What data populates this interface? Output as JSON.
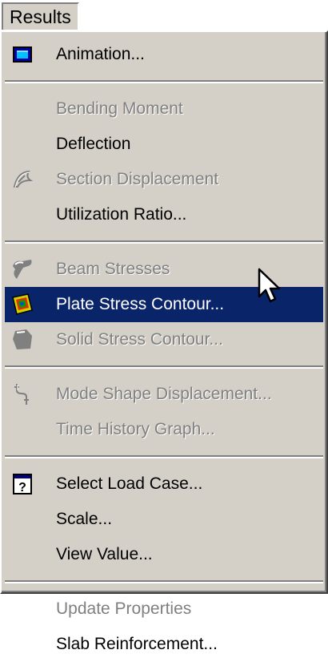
{
  "menu_title": "Results",
  "groups": [
    {
      "items": [
        {
          "label": "Animation...",
          "icon": "animation-icon",
          "enabled": true
        }
      ]
    },
    {
      "items": [
        {
          "label": "Bending Moment",
          "enabled": false
        },
        {
          "label": "Deflection",
          "enabled": true
        },
        {
          "label": "Section Displacement",
          "icon": "section-displacement-icon",
          "enabled": false
        },
        {
          "label": "Utilization Ratio...",
          "enabled": true
        }
      ]
    },
    {
      "items": [
        {
          "label": "Beam Stresses",
          "icon": "beam-stresses-icon",
          "enabled": false
        },
        {
          "label": "Plate Stress Contour...",
          "icon": "plate-stress-icon",
          "enabled": true,
          "highlighted": true
        },
        {
          "label": "Solid Stress Contour...",
          "icon": "solid-stress-icon",
          "enabled": false
        }
      ]
    },
    {
      "items": [
        {
          "label": "Mode Shape Displacement...",
          "icon": "mode-shape-icon",
          "enabled": false
        },
        {
          "label": "Time History Graph...",
          "enabled": false
        }
      ]
    },
    {
      "items": [
        {
          "label": "Select Load Case...",
          "icon": "load-case-icon",
          "enabled": true
        },
        {
          "label": "Scale...",
          "enabled": true
        },
        {
          "label": "View Value...",
          "enabled": true
        }
      ]
    },
    {
      "items": [
        {
          "label": "Update Properties",
          "enabled": false
        },
        {
          "label": "Slab Reinforcement...",
          "enabled": true
        }
      ]
    }
  ],
  "colors": {
    "menu_bg": "#d4d0c8",
    "highlight": "#0a246a",
    "disabled_text": "#808080"
  }
}
